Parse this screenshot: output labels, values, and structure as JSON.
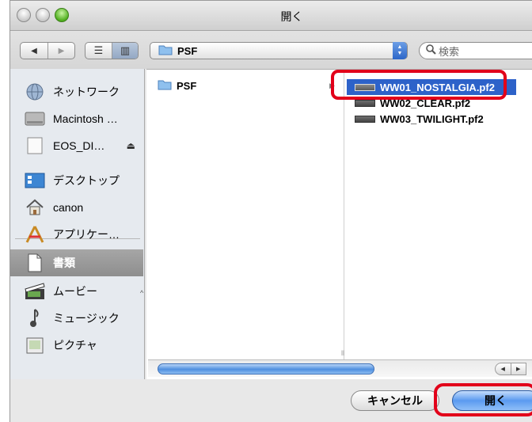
{
  "window": {
    "title": "開く"
  },
  "toolbar": {
    "back_icon": "◀",
    "forward_icon": "▶",
    "list_view_icon": "☰",
    "column_view_icon": "▥",
    "location": "PSF",
    "search_placeholder": "検索"
  },
  "sidebar": {
    "items": [
      {
        "label": "ネットワーク",
        "icon": "network-icon"
      },
      {
        "label": "Macintosh …",
        "icon": "hard-disk-icon"
      },
      {
        "label": "EOS_DI… ",
        "icon": "external-disk-icon",
        "eject": "⏏"
      },
      {
        "label": "デスクトップ",
        "icon": "desktop-icon"
      },
      {
        "label": "canon",
        "icon": "home-icon"
      },
      {
        "label": "アプリケー…",
        "icon": "applications-icon"
      },
      {
        "label": "書類",
        "icon": "documents-icon",
        "selected": true
      },
      {
        "label": "ムービー",
        "icon": "movies-icon"
      },
      {
        "label": "ミュージック",
        "icon": "music-icon"
      },
      {
        "label": "ピクチャ",
        "icon": "pictures-icon"
      }
    ]
  },
  "browser": {
    "column1": [
      {
        "label": "PSF",
        "type": "folder"
      }
    ],
    "column2": [
      {
        "label": "WW01_NOSTALGIA.pf2",
        "selected": true
      },
      {
        "label": "WW02_CLEAR.pf2"
      },
      {
        "label": "WW03_TWILIGHT.pf2"
      }
    ]
  },
  "buttons": {
    "cancel": "キャンセル",
    "open": "開く"
  },
  "colors": {
    "selection": "#2d62c9",
    "highlight_ring": "#e2001a",
    "sidebar_selected": "#999999"
  }
}
